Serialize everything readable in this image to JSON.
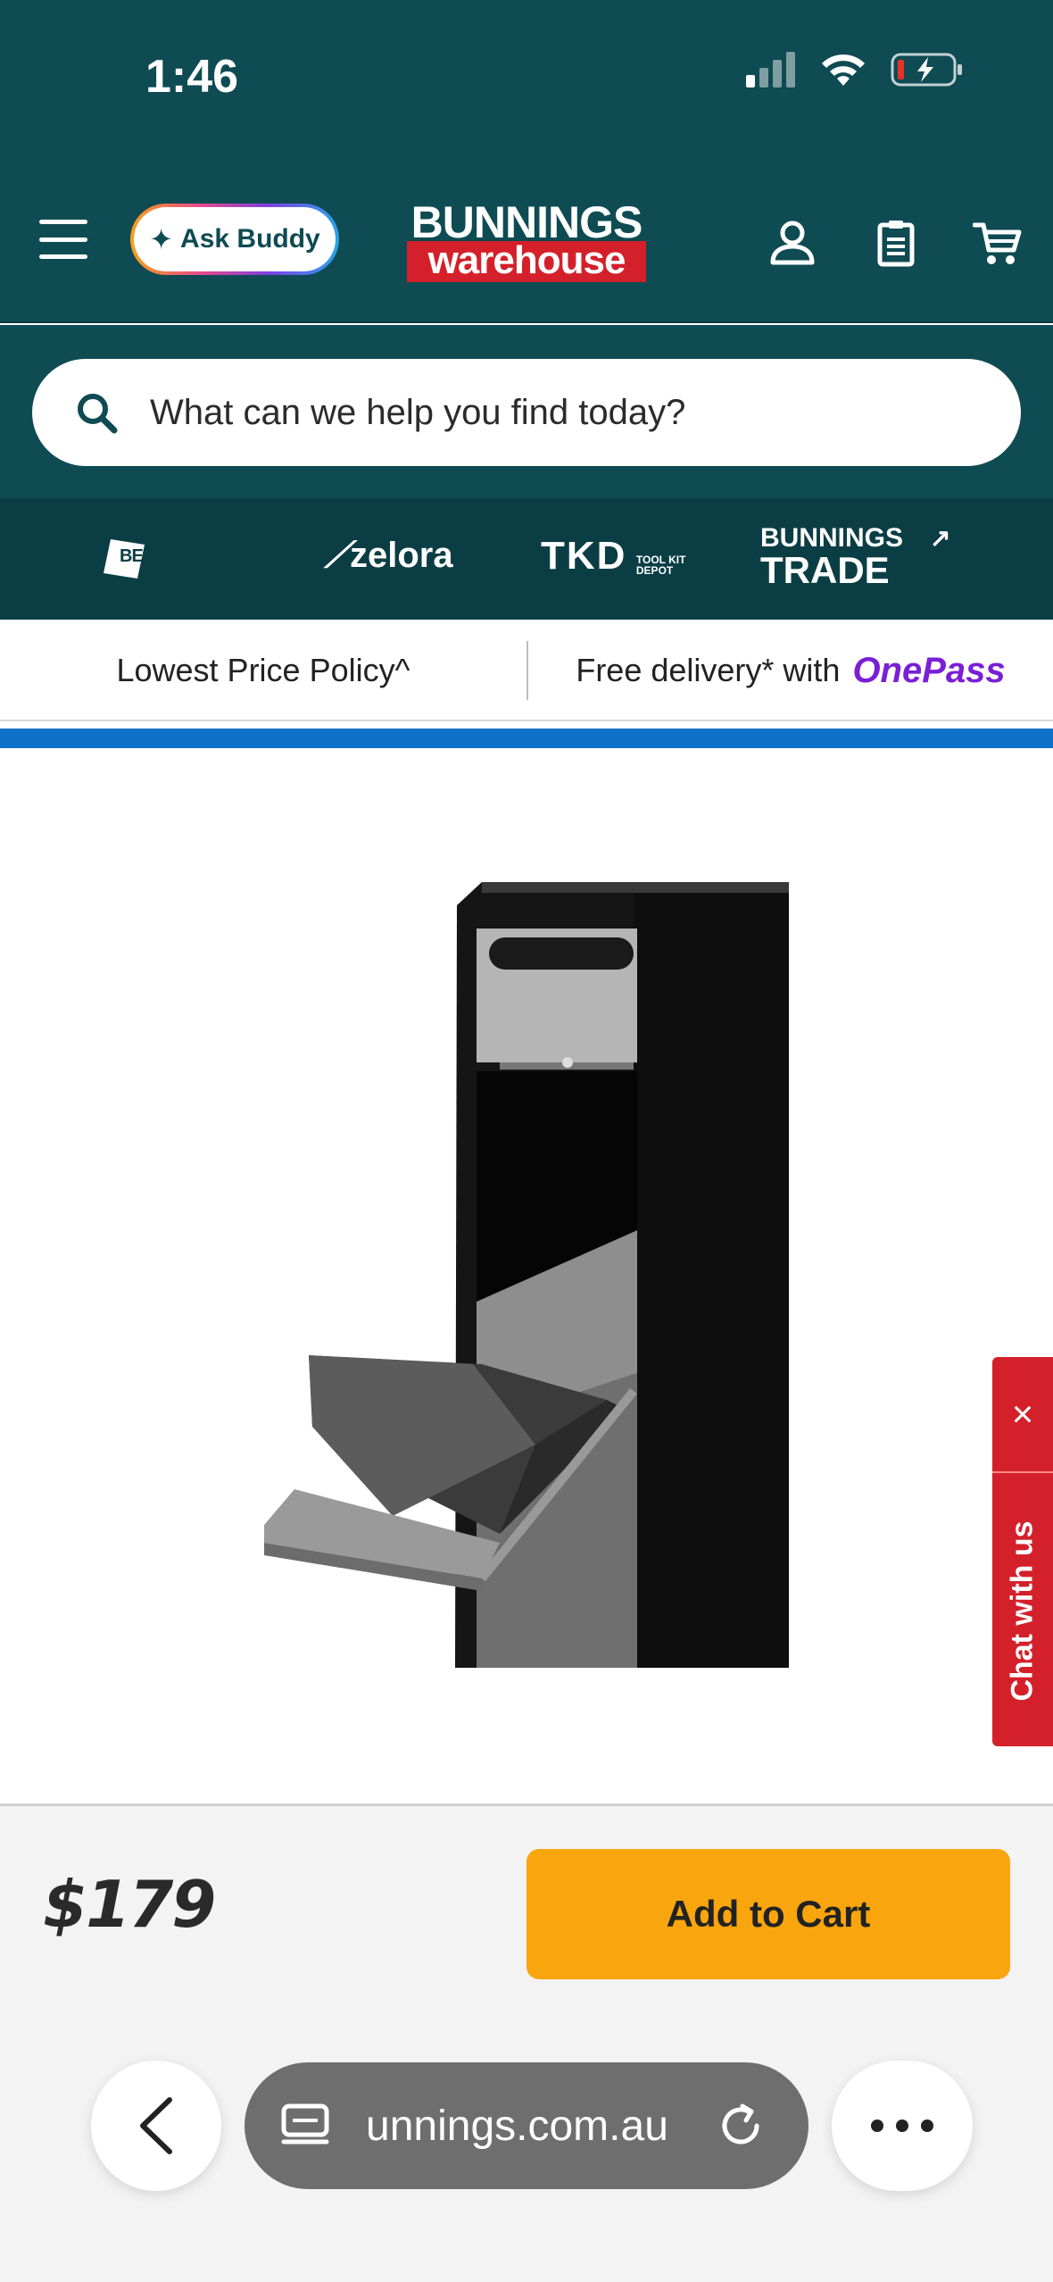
{
  "status_bar": {
    "time": "1:46"
  },
  "header": {
    "ask_buddy_label": "Ask Buddy",
    "logo_top": "BUNNINGS",
    "logo_bottom": "warehouse"
  },
  "search": {
    "placeholder": "What can we help you find today?"
  },
  "brands": {
    "beaumont": "BEAUMONT TILES",
    "zelora": "zelora",
    "tkd": "TKD",
    "tkd_sub": "TOOL KIT DEPOT",
    "trade_top": "BUNNINGS",
    "trade_bottom": "TRADE",
    "trade_arrow": "↗"
  },
  "promo": {
    "left": "Lowest Price Policy^",
    "right": "Free delivery* with",
    "onepass": "OnePass"
  },
  "chat": {
    "close": "×",
    "label": "Chat with us"
  },
  "product": {
    "price": "$179",
    "add_to_cart": "Add to Cart"
  },
  "browser": {
    "url": "unnings.com.au"
  },
  "colors": {
    "header": "#0f4b52",
    "accent": "#d4202a",
    "cta": "#f9a50d",
    "blue_bar": "#0d72c7",
    "onepass": "#7a1fd6"
  }
}
